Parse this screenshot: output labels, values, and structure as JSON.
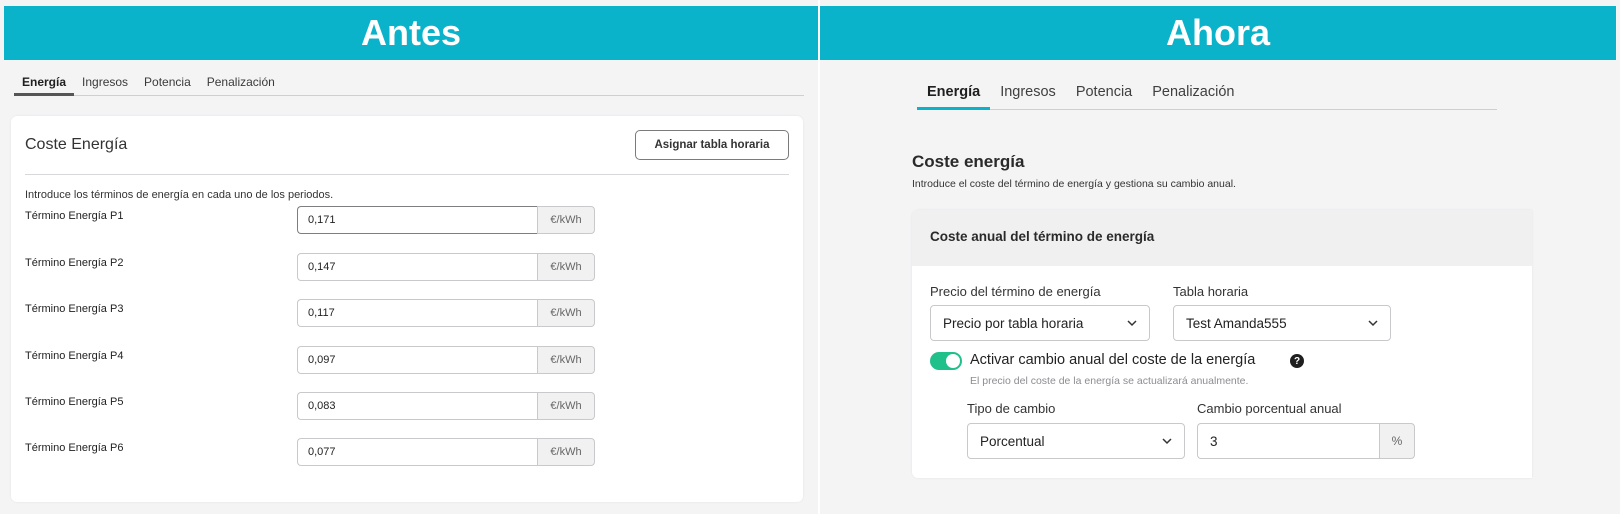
{
  "before": {
    "banner": "Antes",
    "tabs": [
      {
        "label": "Energía",
        "active": true
      },
      {
        "label": "Ingresos",
        "active": false
      },
      {
        "label": "Potencia",
        "active": false
      },
      {
        "label": "Penalización",
        "active": false
      }
    ],
    "card": {
      "title": "Coste Energía",
      "assign_button": "Asignar tabla horaria",
      "intro": "Introduce los términos de energía en cada uno de los periodos.",
      "rows": [
        {
          "label": "Término Energía P1",
          "value": "0,171",
          "unit": "€/kWh"
        },
        {
          "label": "Término Energía P2",
          "value": "0,147",
          "unit": "€/kWh"
        },
        {
          "label": "Término Energía P3",
          "value": "0,117",
          "unit": "€/kWh"
        },
        {
          "label": "Término Energía P4",
          "value": "0,097",
          "unit": "€/kWh"
        },
        {
          "label": "Término Energía P5",
          "value": "0,083",
          "unit": "€/kWh"
        },
        {
          "label": "Término Energía P6",
          "value": "0,077",
          "unit": "€/kWh"
        }
      ]
    }
  },
  "after": {
    "banner": "Ahora",
    "tabs": [
      {
        "label": "Energía",
        "active": true
      },
      {
        "label": "Ingresos",
        "active": false
      },
      {
        "label": "Potencia",
        "active": false
      },
      {
        "label": "Penalización",
        "active": false
      }
    ],
    "section_title": "Coste energía",
    "section_subtitle": "Introduce el coste del término de energía y gestiona su cambio anual.",
    "card": {
      "title": "Coste anual del término de energía",
      "price_label": "Precio del término de energía",
      "price_value": "Precio por tabla horaria",
      "schedule_label": "Tabla horaria",
      "schedule_value": "Test Amanda555",
      "toggle_label": "Activar cambio anual del coste de la energía",
      "toggle_on": true,
      "help_glyph": "?",
      "toggle_hint": "El precio del coste de la energía se actualizará anualmente.",
      "change_type_label": "Tipo de cambio",
      "change_type_value": "Porcentual",
      "annual_change_label": "Cambio porcentual anual",
      "annual_change_value": "3",
      "annual_change_unit": "%"
    }
  },
  "colors": {
    "banner": "#0ab3c9",
    "toggle_on": "#1fc089",
    "active_tab_after": "#0ab3c9"
  }
}
